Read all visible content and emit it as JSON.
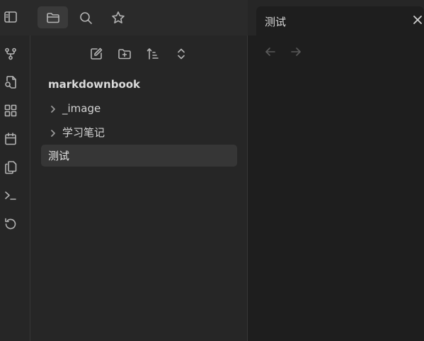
{
  "topbar": {
    "icons": [
      "sidebar-toggle-icon",
      "folder-icon",
      "search-icon",
      "star-icon"
    ]
  },
  "ribbon": {
    "icons": [
      "git-branch-icon",
      "file-search-icon",
      "layout-grid-icon",
      "calendar-icon",
      "copy-icon",
      "terminal-icon",
      "history-icon"
    ]
  },
  "explorer": {
    "nav_icons": [
      "new-note-icon",
      "new-folder-icon",
      "sort-icon",
      "collapse-expand-icon"
    ],
    "vault_name": "markdownbook",
    "items": [
      {
        "label": "_image",
        "type": "folder"
      },
      {
        "label": "学习笔记",
        "type": "folder"
      },
      {
        "label": "测试",
        "type": "file",
        "active": true
      }
    ]
  },
  "editor": {
    "tab_title": "测试",
    "nav": [
      "back-arrow-icon",
      "forward-arrow-icon"
    ]
  },
  "colors": {
    "ribbon_bg": "#262626",
    "editor_bg": "#1e1e1e",
    "active_item_bg": "#363636",
    "text": "#dadada"
  }
}
